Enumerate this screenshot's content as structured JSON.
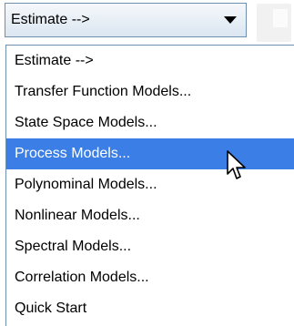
{
  "combo": {
    "selected_label": "Estimate -->",
    "arrow_icon": "chevron-down-icon"
  },
  "menu": {
    "items": [
      {
        "label": "Estimate -->",
        "selected": false
      },
      {
        "label": "Transfer Function Models...",
        "selected": false
      },
      {
        "label": "State Space Models...",
        "selected": false
      },
      {
        "label": "Process Models...",
        "selected": true
      },
      {
        "label": "Polynominal Models...",
        "selected": false
      },
      {
        "label": "Nonlinear Models...",
        "selected": false
      },
      {
        "label": "Spectral Models...",
        "selected": false
      },
      {
        "label": "Correlation Models...",
        "selected": false
      },
      {
        "label": "Quick Start",
        "selected": false
      }
    ]
  },
  "colors": {
    "selection": "#3b7ee6",
    "border": "#6f8fae"
  },
  "cursor": {
    "icon": "mouse-pointer-icon"
  }
}
